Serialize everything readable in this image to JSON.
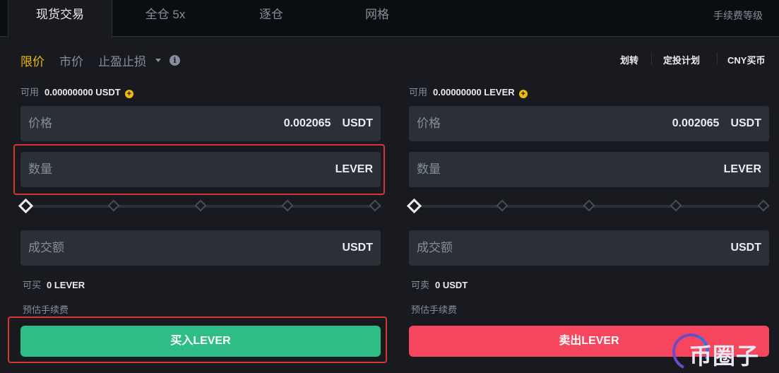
{
  "tabs": [
    {
      "label": "现货交易",
      "active": true
    },
    {
      "label": "全仓 5x",
      "active": false
    },
    {
      "label": "逐仓",
      "active": false
    },
    {
      "label": "网格",
      "active": false
    }
  ],
  "fee_level_link": "手续费等级",
  "order_types": {
    "limit": "限价",
    "market": "市价",
    "stop": "止盈止损"
  },
  "top_links": {
    "transfer": "划转",
    "auto_invest": "定投计划",
    "cny_buy": "CNY买币"
  },
  "buy_panel": {
    "available_label": "可用",
    "available_value": "0.00000000 USDT",
    "price_label": "价格",
    "price_value": "0.002065",
    "price_unit": "USDT",
    "amount_label": "数量",
    "amount_unit": "LEVER",
    "slider_percent": 0,
    "total_label": "成交额",
    "total_unit": "USDT",
    "max_label": "可买",
    "max_value": "0 LEVER",
    "fee_label": "预估手续费",
    "button": "买入LEVER"
  },
  "sell_panel": {
    "available_label": "可用",
    "available_value": "0.00000000 LEVER",
    "price_label": "价格",
    "price_value": "0.002065",
    "price_unit": "USDT",
    "amount_label": "数量",
    "amount_unit": "LEVER",
    "slider_percent": 0,
    "total_label": "成交额",
    "total_unit": "USDT",
    "max_label": "可卖",
    "max_value": "0 USDT",
    "fee_label": "预估手续费",
    "button": "卖出LEVER"
  },
  "watermark": "币圈子",
  "colors": {
    "accent": "#f0b90b",
    "buy": "#2ebd85",
    "sell": "#f6465d",
    "highlight": "#d9352f"
  },
  "icons": {
    "info": "info-icon",
    "plus": "plus-circle-icon",
    "caret": "caret-down-icon"
  }
}
